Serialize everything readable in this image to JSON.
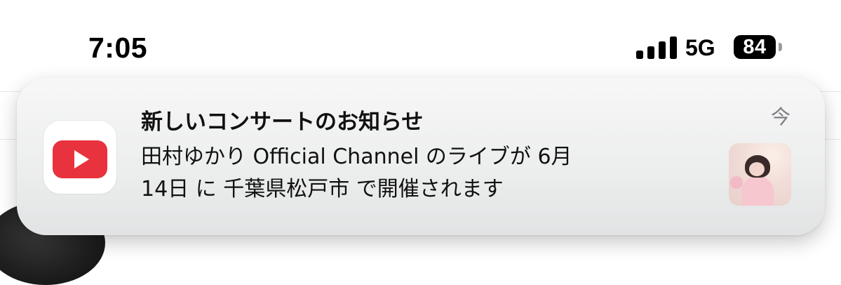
{
  "status_bar": {
    "time": "7:05",
    "network": "5G",
    "battery_level": "84",
    "signal_bars": 4
  },
  "notification": {
    "app_icon": "youtube-app-icon",
    "title": "新しいコンサートのお知らせ",
    "body_line_1": "田村ゆかり Official Channel のライブが 6月",
    "body_line_2": "14日 に 千葉県松戸市 で開催されます",
    "time": "今",
    "thumbnail": "channel-thumbnail"
  },
  "colors": {
    "youtube_red": "#e8323d",
    "banner_background": "#eceded",
    "secondary_text": "#7b7b7f"
  }
}
